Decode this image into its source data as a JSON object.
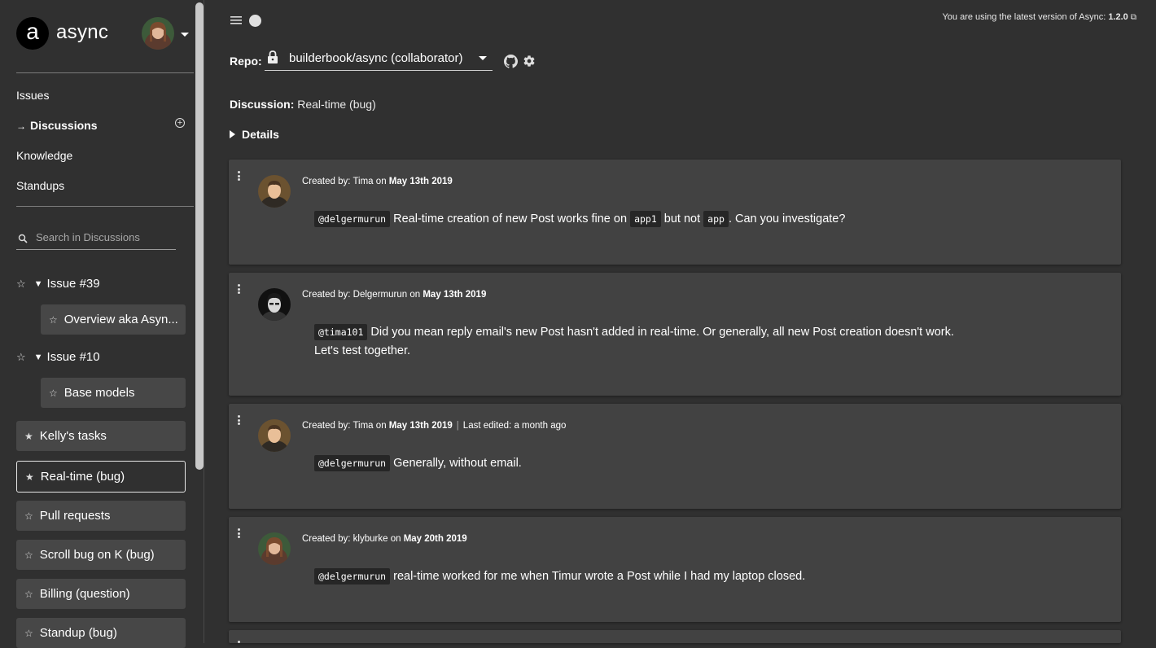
{
  "app": {
    "brand": "async",
    "logo_letter": "a"
  },
  "sidebar": {
    "nav": [
      {
        "label": "Issues"
      },
      {
        "label": "Discussions"
      },
      {
        "label": "Knowledge"
      },
      {
        "label": "Standups"
      }
    ],
    "search_placeholder": "Search in Discussions",
    "groups": [
      {
        "label": "Issue #39",
        "items": [
          "Overview aka Asyn..."
        ]
      },
      {
        "label": "Issue #10",
        "items": [
          "Base models"
        ]
      }
    ],
    "discussions": [
      {
        "label": "Kelly's tasks",
        "starred": true,
        "selected": false
      },
      {
        "label": "Real-time (bug)",
        "starred": true,
        "selected": true
      },
      {
        "label": "Pull requests",
        "starred": false,
        "selected": false
      },
      {
        "label": "Scroll bug on K (bug)",
        "starred": false,
        "selected": false
      },
      {
        "label": "Billing (question)",
        "starred": false,
        "selected": false
      },
      {
        "label": "Standup (bug)",
        "starred": false,
        "selected": false
      }
    ]
  },
  "header": {
    "version_text": "You are using the latest version of Async:",
    "version": "1.2.0",
    "repo_label": "Repo:",
    "repo_value": "builderbook/async (collaborator)"
  },
  "discussion": {
    "label": "Discussion:",
    "title": "Real-time (bug)",
    "details_label": "Details"
  },
  "posts": [
    {
      "created_label": "Created by:",
      "author": "Tima",
      "on": "on",
      "date": "May 13th 2019",
      "mention": "@delgermurun",
      "t1": "Real-time creation of new Post works fine on",
      "c1": "app1",
      "t2": "but not",
      "c2": "app",
      "t3": ". Can you investigate?"
    },
    {
      "created_label": "Created by:",
      "author": "Delgermurun",
      "on": "on",
      "date": "May 13th 2019",
      "mention": "@tima101",
      "line1": "Did you mean reply email's new Post hasn't added in real-time. Or generally, all new Post creation doesn't work.",
      "line2": "Let's test together."
    },
    {
      "created_label": "Created by:",
      "author": "Tima",
      "on": "on",
      "date": "May 13th 2019",
      "edited": "Last edited: a month ago",
      "mention": "@delgermurun",
      "text": "Generally, without email."
    },
    {
      "created_label": "Created by:",
      "author": "klyburke",
      "on": "on",
      "date": "May 20th 2019",
      "mention": "@delgermurun",
      "text": "real-time worked for me when Timur wrote a Post while I had my laptop closed."
    }
  ]
}
